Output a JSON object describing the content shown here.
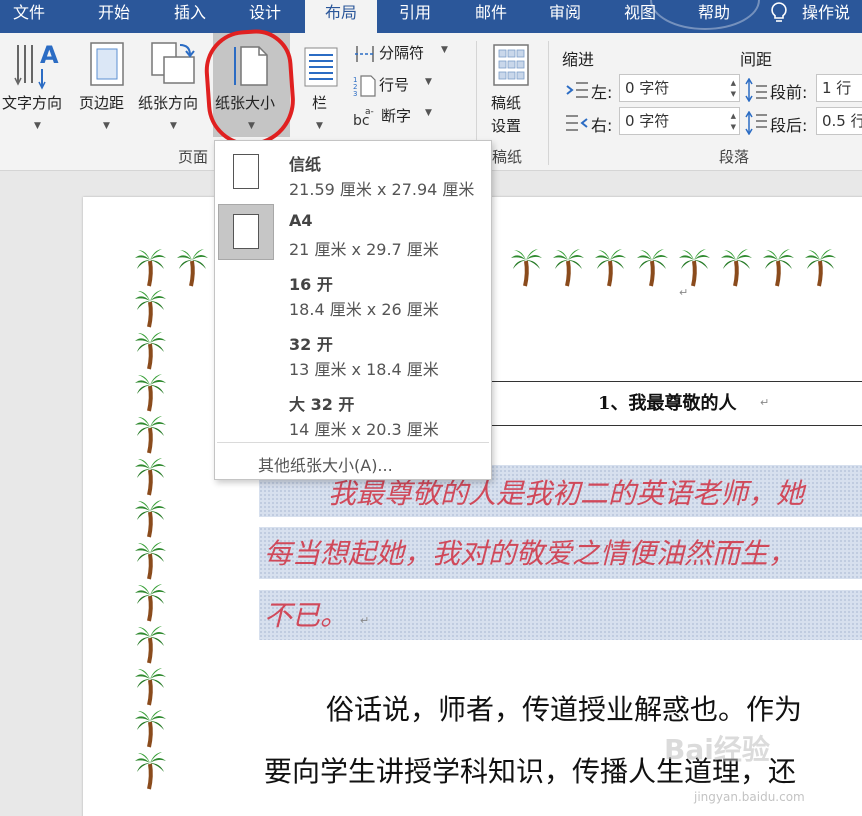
{
  "tabs": [
    {
      "label": "文件",
      "active": false
    },
    {
      "label": "开始",
      "active": false
    },
    {
      "label": "插入",
      "active": false
    },
    {
      "label": "设计",
      "active": false
    },
    {
      "label": "布局",
      "active": true
    },
    {
      "label": "引用",
      "active": false
    },
    {
      "label": "邮件",
      "active": false
    },
    {
      "label": "审阅",
      "active": false
    },
    {
      "label": "视图",
      "active": false
    },
    {
      "label": "帮助",
      "active": false
    }
  ],
  "tell_me": "操作说",
  "ribbon": {
    "text_direction": "文字方向",
    "margins": "页边距",
    "orientation": "纸张方向",
    "size": "纸张大小",
    "columns": "栏",
    "breaks": "分隔符",
    "line_numbers": "行号",
    "hyphenation": "断字",
    "manuscript_line1": "稿纸",
    "manuscript_line2": "设置",
    "group_page_setup": "页面",
    "group_manuscript": "稿纸",
    "indent_header": "缩进",
    "spacing_header": "间距",
    "indent_left_label": "左:",
    "indent_left_value": "0 字符",
    "indent_right_label": "右:",
    "indent_right_value": "0 字符",
    "space_before_label": "段前:",
    "space_before_value": "1 行",
    "space_after_label": "段后:",
    "space_after_value": "0.5 行",
    "group_paragraph": "段落"
  },
  "paper_menu": {
    "items": [
      {
        "name": "信纸",
        "dims": "21.59 厘米 x 27.94 厘米",
        "selected": false
      },
      {
        "name": "A4",
        "dims": "21 厘米 x 29.7 厘米",
        "selected": true
      },
      {
        "name": "16 开",
        "dims": "18.4 厘米 x 26 厘米",
        "selected": false
      },
      {
        "name": "32 开",
        "dims": "13 厘米 x 18.4 厘米",
        "selected": false
      },
      {
        "name": "大 32 开",
        "dims": "14 厘米 x 20.3 厘米",
        "selected": false
      }
    ],
    "more": "其他纸张大小(A)..."
  },
  "document": {
    "heading": "1、我最尊敬的人",
    "highlighted_lines": [
      "我最尊敬的人是我初二的英语老师，她",
      "每当想起她，我对的敬爱之情便油然而生，",
      "不已。"
    ],
    "body_lines": [
      "俗话说，师者，传道授业解惑也。作为",
      "要向学生讲授学科知识，传播人生道理，还"
    ]
  },
  "watermark": {
    "main": "Bai经验",
    "sub": "jingyan.baidu.com"
  },
  "colors": {
    "ribbon_blue": "#2b579a",
    "highlight_red": "#d0495a",
    "annotation_red": "#e02020"
  }
}
